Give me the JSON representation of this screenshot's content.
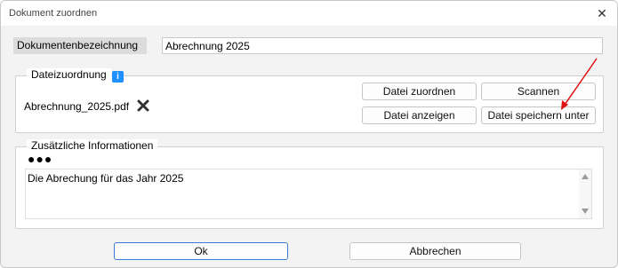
{
  "window": {
    "title": "Dokument zuordnen",
    "close_glyph": "✕"
  },
  "document_name": {
    "label": "Dokumentenbezeichnung",
    "value": "Abrechnung 2025"
  },
  "file_assignment": {
    "legend": "Dateizuordnung",
    "info_glyph": "i",
    "file_name": "Abrechnung_2025.pdf",
    "buttons": {
      "assign": "Datei zuordnen",
      "scan": "Scannen",
      "show": "Datei anzeigen",
      "save_as": "Datei speichern unter"
    }
  },
  "additional_info": {
    "legend": "Zusätzliche Informationen",
    "more_glyph": "●●●",
    "text": "Die Abrechung für das Jahr 2025"
  },
  "footer": {
    "ok": "Ok",
    "cancel": "Abbrechen"
  },
  "colors": {
    "info_icon": "#1e90ff",
    "annotation_arrow": "#e01010",
    "ok_border": "#3b7bd6"
  },
  "annotation": {
    "arrow_points_to": "save-as-button"
  }
}
